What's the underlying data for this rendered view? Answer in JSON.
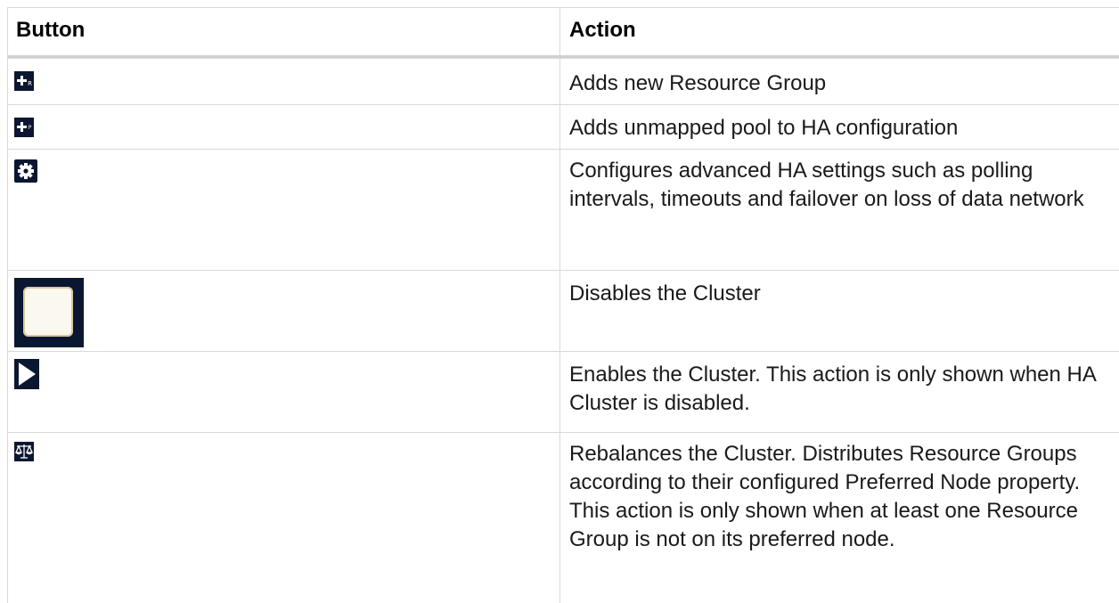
{
  "table": {
    "headers": {
      "button": "Button",
      "action": "Action"
    },
    "rows": [
      {
        "icon": "add-resource-group-icon",
        "action": "Adds new Resource Group",
        "icon_letter": "R"
      },
      {
        "icon": "add-pool-icon",
        "action": "Adds unmapped pool to HA configuration",
        "icon_letter": "P"
      },
      {
        "icon": "gear-icon",
        "action": "Configures advanced HA settings such as polling intervals, timeouts and failover on loss of data network"
      },
      {
        "icon": "stop-icon",
        "action": "Disables the Cluster"
      },
      {
        "icon": "play-icon",
        "action": "Enables the Cluster. This action is only shown when HA Cluster is disabled."
      },
      {
        "icon": "balance-scale-icon",
        "action": "Rebalances the Cluster. Distributes Resource Groups according to their configured Preferred Node property. This action is only shown when at least one Resource Group is not on its preferred node."
      }
    ]
  },
  "colors": {
    "icon_bg": "#0b1730",
    "border": "#d9d9d9",
    "text": "#1a1a1a"
  }
}
